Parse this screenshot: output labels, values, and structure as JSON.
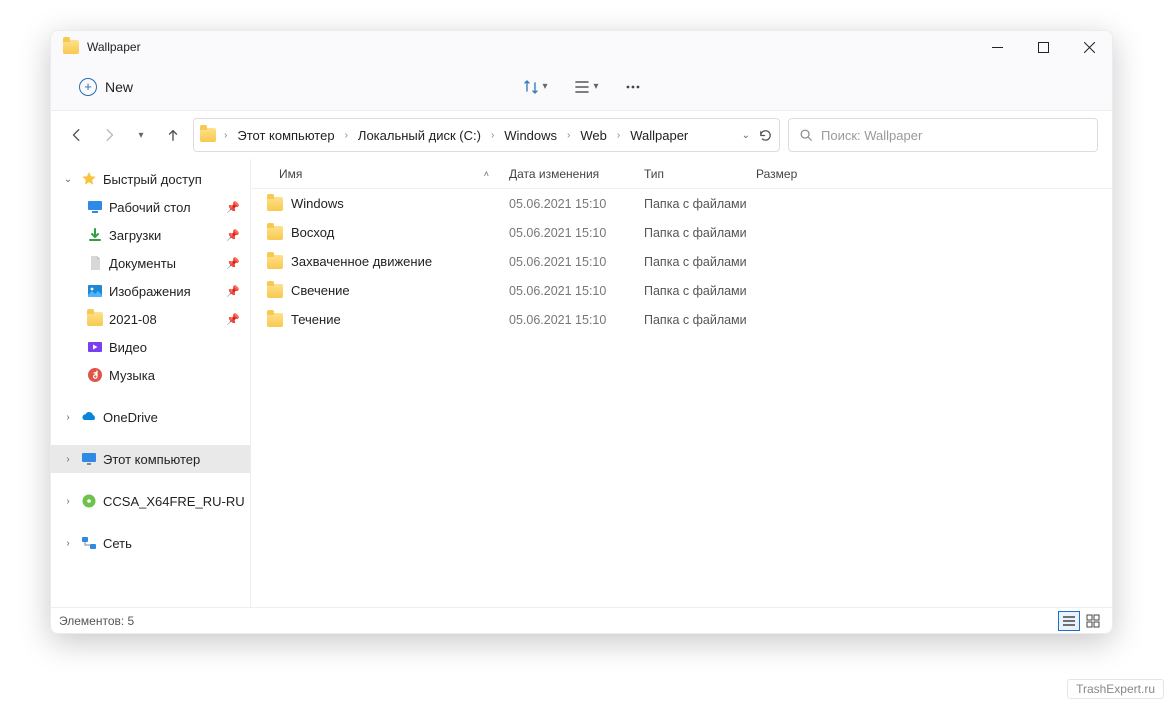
{
  "window": {
    "title": "Wallpaper"
  },
  "cmdbar": {
    "new_label": "New"
  },
  "breadcrumb": [
    "Этот компьютер",
    "Локальный диск (C:)",
    "Windows",
    "Web",
    "Wallpaper"
  ],
  "search": {
    "placeholder": "Поиск: Wallpaper"
  },
  "navpane": {
    "quick": {
      "label": "Быстрый доступ",
      "expanded": true,
      "items": [
        {
          "label": "Рабочий стол",
          "icon": "desktop",
          "pinned": true
        },
        {
          "label": "Загрузки",
          "icon": "downloads",
          "pinned": true
        },
        {
          "label": "Документы",
          "icon": "documents",
          "pinned": true
        },
        {
          "label": "Изображения",
          "icon": "pictures",
          "pinned": true
        },
        {
          "label": "2021-08",
          "icon": "folder",
          "pinned": true
        },
        {
          "label": "Видео",
          "icon": "videos",
          "pinned": false
        },
        {
          "label": "Музыка",
          "icon": "music",
          "pinned": false
        }
      ]
    },
    "roots": [
      {
        "label": "OneDrive",
        "icon": "onedrive",
        "expanded": false
      },
      {
        "label": "Этот компьютер",
        "icon": "thispc",
        "expanded": false,
        "selected": true
      },
      {
        "label": "CCSA_X64FRE_RU-RU",
        "icon": "disc",
        "expanded": false
      },
      {
        "label": "Сеть",
        "icon": "network",
        "expanded": false
      }
    ]
  },
  "columns": {
    "name": "Имя",
    "date": "Дата изменения",
    "type": "Тип",
    "size": "Размер",
    "sort": "name_asc"
  },
  "rows": [
    {
      "name": "Windows",
      "date": "05.06.2021 15:10",
      "type": "Папка с файлами",
      "size": ""
    },
    {
      "name": "Восход",
      "date": "05.06.2021 15:10",
      "type": "Папка с файлами",
      "size": ""
    },
    {
      "name": "Захваченное движение",
      "date": "05.06.2021 15:10",
      "type": "Папка с файлами",
      "size": ""
    },
    {
      "name": "Свечение",
      "date": "05.06.2021 15:10",
      "type": "Папка с файлами",
      "size": ""
    },
    {
      "name": "Течение",
      "date": "05.06.2021 15:10",
      "type": "Папка с файлами",
      "size": ""
    }
  ],
  "statusbar": {
    "text": "Элементов: 5"
  },
  "watermark": "TrashExpert.ru"
}
